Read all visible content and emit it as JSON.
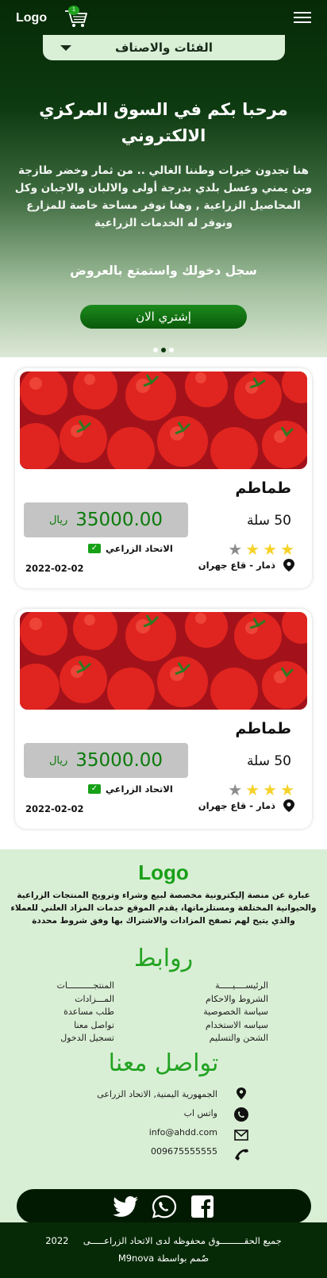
{
  "header": {
    "logo": "Logo",
    "cart_count": "1",
    "categories_label": "الفئات والاصناف"
  },
  "hero": {
    "title": "مرحبا بكم في السوق المركزي الالكتروني",
    "description": "هنا تجدون خيرات وطننا الغالي .. من ثمار وخضر طازجة وبن يمني وعسل بلدي بدرجة أولى والالبان والاجبان وكل المحاصيل الزراعية , وهنا نوفر مساحة خاصة للمزارع ونوفر له الخدمات الزراعية",
    "cta_text": "سجل دخولك واستمتع بالعروض",
    "buy_button": "إشتري الان",
    "slide_count": 3,
    "active_slide": 1
  },
  "products": [
    {
      "name": "طماطم",
      "quantity": "50",
      "unit": "سلة",
      "price": "35000.00",
      "currency": "ريال",
      "rating": 3,
      "rating_max": 4,
      "seller": "الاتحاد الزراعي",
      "location": "ذمار - قاع جهران",
      "date": "2022-02-02"
    },
    {
      "name": "طماطم",
      "quantity": "50",
      "unit": "سلة",
      "price": "35000.00",
      "currency": "ريال",
      "rating": 3,
      "rating_max": 4,
      "seller": "الاتحاد الزراعي",
      "location": "ذمار - قاع جهران",
      "date": "2022-02-02"
    }
  ],
  "footer": {
    "logo": "Logo",
    "about": "عبارة عن منصة إليكترونية مخصصة لبيع وشراء وترويج المنتجات الزراعية والحيوانية المختلفة ومستلزماتها، يقدم الموقع خدمات المزاد العلني للعملاء والذي يتيح لهم تصفح المزادات والاشتراك بها وفق شروط محددة",
    "links_heading": "روابط",
    "links_right": [
      "الرئيســــيـــــة",
      "الشروط والاحكام",
      "سياسة الخصوصية",
      "سياسه الاستخدام",
      "الشحن والتسليم"
    ],
    "links_left": [
      "المنتجــــــــــات",
      "المـــزادات",
      "طلب مساعدة",
      "تواصل معنا",
      "تسجيل الدخول"
    ],
    "contact_heading": "تواصل معنا",
    "address": "الجمهورية اليمنية, الاتحاد الزراعى",
    "whatsapp": "واتس اب",
    "email": "info@ahdd.com",
    "phone": "009675555555",
    "copyright": "جميع الحقـــــــــوق محفوظه لدى الاتحاد الزراعـــــى",
    "year": "2022",
    "credit": "صٌمم بواسطة",
    "credit_brand": "M9nova"
  },
  "colors": {
    "brand_green": "#19a019",
    "dark_green": "#062a06",
    "footer_bg": "#d9efd5",
    "price_green": "#0a7a0a",
    "star_yellow": "#f6d22a"
  },
  "icons": [
    "cart-icon",
    "menu-icon",
    "chevron-down-icon",
    "star-icon",
    "check-icon",
    "location-pin-icon",
    "whatsapp-icon",
    "email-icon",
    "phone-icon",
    "twitter-icon",
    "facebook-icon"
  ]
}
